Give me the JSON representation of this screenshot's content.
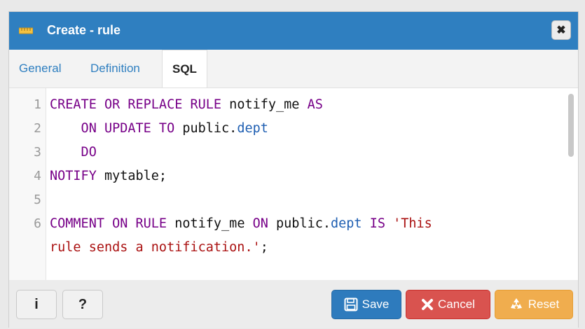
{
  "dialog": {
    "title": "Create - rule",
    "close_icon": "✖"
  },
  "tabs": [
    {
      "label": "General"
    },
    {
      "label": "Definition"
    },
    {
      "label": "SQL"
    }
  ],
  "editor": {
    "line_numbers": [
      "1",
      "2",
      "3",
      "4",
      "5",
      "6"
    ],
    "lines": [
      {
        "segments": [
          {
            "t": "CREATE OR REPLACE RULE",
            "c": "kw"
          },
          {
            "t": " notify_me ",
            "c": ""
          },
          {
            "t": "AS",
            "c": "kw"
          }
        ]
      },
      {
        "segments": [
          {
            "t": "    ON UPDATE TO",
            "c": "kw"
          },
          {
            "t": " public.",
            "c": ""
          },
          {
            "t": "dept",
            "c": "tbl"
          }
        ]
      },
      {
        "segments": [
          {
            "t": "    DO",
            "c": "kw"
          }
        ]
      },
      {
        "segments": [
          {
            "t": "NOTIFY",
            "c": "kw"
          },
          {
            "t": " mytable;",
            "c": ""
          }
        ]
      },
      {
        "segments": []
      },
      {
        "segments": [
          {
            "t": "COMMENT ON RULE",
            "c": "kw"
          },
          {
            "t": " notify_me ",
            "c": ""
          },
          {
            "t": "ON",
            "c": "kw"
          },
          {
            "t": " public.",
            "c": ""
          },
          {
            "t": "dept",
            "c": "tbl"
          },
          {
            "t": " ",
            "c": ""
          },
          {
            "t": "IS",
            "c": "kw"
          },
          {
            "t": " ",
            "c": ""
          },
          {
            "t": "'This",
            "c": "str"
          }
        ]
      },
      {
        "segments": [
          {
            "t": "rule sends a notification.'",
            "c": "str"
          },
          {
            "t": ";",
            "c": ""
          }
        ]
      }
    ]
  },
  "footer": {
    "info_label": "i",
    "help_label": "?",
    "save_label": "Save",
    "cancel_label": "Cancel",
    "reset_label": "Reset"
  },
  "colors": {
    "titlebar": "#2f7fc0",
    "save": "#2e7bbd",
    "cancel": "#d9534f",
    "reset": "#f0ad4e"
  }
}
